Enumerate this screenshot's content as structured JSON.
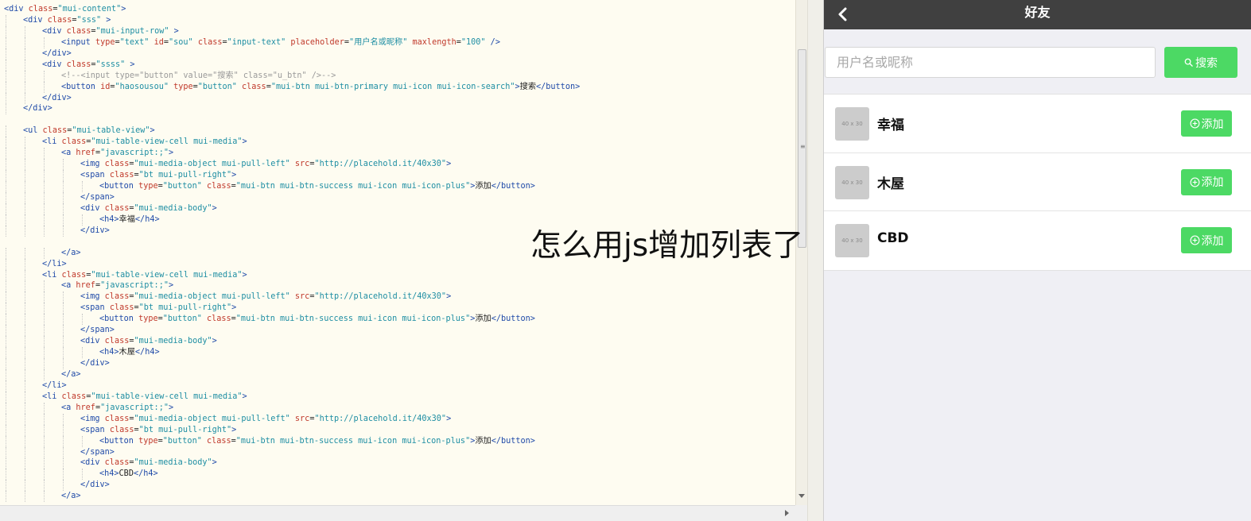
{
  "editor": {
    "lines": [
      {
        "indent": 0,
        "segs": [
          [
            "t",
            "<div "
          ],
          [
            "a",
            "class"
          ],
          [
            "x",
            "="
          ],
          [
            "s",
            "\"mui-content\""
          ],
          [
            "t",
            ">"
          ]
        ]
      },
      {
        "indent": 1,
        "segs": [
          [
            "t",
            "<div "
          ],
          [
            "a",
            "class"
          ],
          [
            "x",
            "="
          ],
          [
            "s",
            "\"sss\""
          ],
          [
            "t",
            " >"
          ]
        ]
      },
      {
        "indent": 2,
        "segs": [
          [
            "t",
            "<div "
          ],
          [
            "a",
            "class"
          ],
          [
            "x",
            "="
          ],
          [
            "s",
            "\"mui-input-row\""
          ],
          [
            "t",
            " >"
          ]
        ]
      },
      {
        "indent": 3,
        "segs": [
          [
            "t",
            "<input "
          ],
          [
            "a",
            "type"
          ],
          [
            "x",
            "="
          ],
          [
            "s",
            "\"text\""
          ],
          [
            "x",
            " "
          ],
          [
            "a",
            "id"
          ],
          [
            "x",
            "="
          ],
          [
            "s",
            "\"sou\""
          ],
          [
            "x",
            " "
          ],
          [
            "a",
            "class"
          ],
          [
            "x",
            "="
          ],
          [
            "s",
            "\"input-text\""
          ],
          [
            "x",
            " "
          ],
          [
            "a",
            "placeholder"
          ],
          [
            "x",
            "="
          ],
          [
            "s",
            "\"用户名或昵称\""
          ],
          [
            "x",
            " "
          ],
          [
            "a",
            "maxlength"
          ],
          [
            "x",
            "="
          ],
          [
            "s",
            "\"100\""
          ],
          [
            "t",
            " />"
          ]
        ]
      },
      {
        "indent": 2,
        "segs": [
          [
            "t",
            "</div>"
          ]
        ]
      },
      {
        "indent": 2,
        "segs": [
          [
            "t",
            "<div "
          ],
          [
            "a",
            "class"
          ],
          [
            "x",
            "="
          ],
          [
            "s",
            "\"ssss\""
          ],
          [
            "t",
            " >"
          ]
        ]
      },
      {
        "indent": 3,
        "segs": [
          [
            "c",
            "<!--<input type=\"button\" value=\"搜索\" class=\"u_btn\" />-->"
          ]
        ]
      },
      {
        "indent": 3,
        "segs": [
          [
            "t",
            "<button "
          ],
          [
            "a",
            "id"
          ],
          [
            "x",
            "="
          ],
          [
            "s",
            "\"haosousou\""
          ],
          [
            "x",
            " "
          ],
          [
            "a",
            "type"
          ],
          [
            "x",
            "="
          ],
          [
            "s",
            "\"button\""
          ],
          [
            "x",
            " "
          ],
          [
            "a",
            "class"
          ],
          [
            "x",
            "="
          ],
          [
            "s",
            "\"mui-btn mui-btn-primary mui-icon mui-icon-search\""
          ],
          [
            "t",
            ">"
          ],
          [
            "x",
            "搜索"
          ],
          [
            "t",
            "</button>"
          ]
        ]
      },
      {
        "indent": 2,
        "segs": [
          [
            "t",
            "</div>"
          ]
        ]
      },
      {
        "indent": 1,
        "segs": [
          [
            "t",
            "</div>"
          ]
        ]
      },
      {
        "indent": 0,
        "segs": []
      },
      {
        "indent": 1,
        "segs": [
          [
            "t",
            "<ul "
          ],
          [
            "a",
            "class"
          ],
          [
            "x",
            "="
          ],
          [
            "s",
            "\"mui-table-view\""
          ],
          [
            "t",
            ">"
          ]
        ]
      },
      {
        "indent": 2,
        "segs": [
          [
            "t",
            "<li "
          ],
          [
            "a",
            "class"
          ],
          [
            "x",
            "="
          ],
          [
            "s",
            "\"mui-table-view-cell mui-media\""
          ],
          [
            "t",
            ">"
          ]
        ]
      },
      {
        "indent": 3,
        "segs": [
          [
            "t",
            "<a "
          ],
          [
            "a",
            "href"
          ],
          [
            "x",
            "="
          ],
          [
            "s",
            "\"javascript:;\""
          ],
          [
            "t",
            ">"
          ]
        ]
      },
      {
        "indent": 4,
        "segs": [
          [
            "t",
            "<img "
          ],
          [
            "a",
            "class"
          ],
          [
            "x",
            "="
          ],
          [
            "s",
            "\"mui-media-object mui-pull-left\""
          ],
          [
            "x",
            " "
          ],
          [
            "a",
            "src"
          ],
          [
            "x",
            "="
          ],
          [
            "s",
            "\"http://placehold.it/40x30\""
          ],
          [
            "t",
            ">"
          ]
        ]
      },
      {
        "indent": 4,
        "segs": [
          [
            "t",
            "<span "
          ],
          [
            "a",
            "class"
          ],
          [
            "x",
            "="
          ],
          [
            "s",
            "\"bt mui-pull-right\""
          ],
          [
            "t",
            ">"
          ]
        ]
      },
      {
        "indent": 5,
        "segs": [
          [
            "t",
            "<button "
          ],
          [
            "a",
            "type"
          ],
          [
            "x",
            "="
          ],
          [
            "s",
            "\"button\""
          ],
          [
            "x",
            " "
          ],
          [
            "a",
            "class"
          ],
          [
            "x",
            "="
          ],
          [
            "s",
            "\"mui-btn mui-btn-success mui-icon mui-icon-plus\""
          ],
          [
            "t",
            ">"
          ],
          [
            "x",
            "添加"
          ],
          [
            "t",
            "</button>"
          ]
        ]
      },
      {
        "indent": 4,
        "segs": [
          [
            "t",
            "</span>"
          ]
        ]
      },
      {
        "indent": 4,
        "segs": [
          [
            "t",
            "<div "
          ],
          [
            "a",
            "class"
          ],
          [
            "x",
            "="
          ],
          [
            "s",
            "\"mui-media-body\""
          ],
          [
            "t",
            ">"
          ]
        ]
      },
      {
        "indent": 5,
        "segs": [
          [
            "t",
            "<h4>"
          ],
          [
            "x",
            "幸福"
          ],
          [
            "t",
            "</h4>"
          ]
        ]
      },
      {
        "indent": 4,
        "segs": [
          [
            "t",
            "</div>"
          ]
        ]
      },
      {
        "indent": 0,
        "segs": []
      },
      {
        "indent": 3,
        "segs": [
          [
            "t",
            "</a>"
          ]
        ]
      },
      {
        "indent": 2,
        "segs": [
          [
            "t",
            "</li>"
          ]
        ]
      },
      {
        "indent": 2,
        "segs": [
          [
            "t",
            "<li "
          ],
          [
            "a",
            "class"
          ],
          [
            "x",
            "="
          ],
          [
            "s",
            "\"mui-table-view-cell mui-media\""
          ],
          [
            "t",
            ">"
          ]
        ]
      },
      {
        "indent": 3,
        "segs": [
          [
            "t",
            "<a "
          ],
          [
            "a",
            "href"
          ],
          [
            "x",
            "="
          ],
          [
            "s",
            "\"javascript:;\""
          ],
          [
            "t",
            ">"
          ]
        ]
      },
      {
        "indent": 4,
        "segs": [
          [
            "t",
            "<img "
          ],
          [
            "a",
            "class"
          ],
          [
            "x",
            "="
          ],
          [
            "s",
            "\"mui-media-object mui-pull-left\""
          ],
          [
            "x",
            " "
          ],
          [
            "a",
            "src"
          ],
          [
            "x",
            "="
          ],
          [
            "s",
            "\"http://placehold.it/40x30\""
          ],
          [
            "t",
            ">"
          ]
        ]
      },
      {
        "indent": 4,
        "segs": [
          [
            "t",
            "<span "
          ],
          [
            "a",
            "class"
          ],
          [
            "x",
            "="
          ],
          [
            "s",
            "\"bt mui-pull-right\""
          ],
          [
            "t",
            ">"
          ]
        ]
      },
      {
        "indent": 5,
        "segs": [
          [
            "t",
            "<button "
          ],
          [
            "a",
            "type"
          ],
          [
            "x",
            "="
          ],
          [
            "s",
            "\"button\""
          ],
          [
            "x",
            " "
          ],
          [
            "a",
            "class"
          ],
          [
            "x",
            "="
          ],
          [
            "s",
            "\"mui-btn mui-btn-success mui-icon mui-icon-plus\""
          ],
          [
            "t",
            ">"
          ],
          [
            "x",
            "添加"
          ],
          [
            "t",
            "</button>"
          ]
        ]
      },
      {
        "indent": 4,
        "segs": [
          [
            "t",
            "</span>"
          ]
        ]
      },
      {
        "indent": 4,
        "segs": [
          [
            "t",
            "<div "
          ],
          [
            "a",
            "class"
          ],
          [
            "x",
            "="
          ],
          [
            "s",
            "\"mui-media-body\""
          ],
          [
            "t",
            ">"
          ]
        ]
      },
      {
        "indent": 5,
        "segs": [
          [
            "t",
            "<h4>"
          ],
          [
            "x",
            "木屋"
          ],
          [
            "t",
            "</h4>"
          ]
        ]
      },
      {
        "indent": 4,
        "segs": [
          [
            "t",
            "</div>"
          ]
        ]
      },
      {
        "indent": 3,
        "segs": [
          [
            "t",
            "</a>"
          ]
        ]
      },
      {
        "indent": 2,
        "segs": [
          [
            "t",
            "</li>"
          ]
        ]
      },
      {
        "indent": 2,
        "segs": [
          [
            "t",
            "<li "
          ],
          [
            "a",
            "class"
          ],
          [
            "x",
            "="
          ],
          [
            "s",
            "\"mui-table-view-cell mui-media\""
          ],
          [
            "t",
            ">"
          ]
        ]
      },
      {
        "indent": 3,
        "segs": [
          [
            "t",
            "<a "
          ],
          [
            "a",
            "href"
          ],
          [
            "x",
            "="
          ],
          [
            "s",
            "\"javascript:;\""
          ],
          [
            "t",
            ">"
          ]
        ]
      },
      {
        "indent": 4,
        "segs": [
          [
            "t",
            "<img "
          ],
          [
            "a",
            "class"
          ],
          [
            "x",
            "="
          ],
          [
            "s",
            "\"mui-media-object mui-pull-left\""
          ],
          [
            "x",
            " "
          ],
          [
            "a",
            "src"
          ],
          [
            "x",
            "="
          ],
          [
            "s",
            "\"http://placehold.it/40x30\""
          ],
          [
            "t",
            ">"
          ]
        ]
      },
      {
        "indent": 4,
        "segs": [
          [
            "t",
            "<span "
          ],
          [
            "a",
            "class"
          ],
          [
            "x",
            "="
          ],
          [
            "s",
            "\"bt mui-pull-right\""
          ],
          [
            "t",
            ">"
          ]
        ]
      },
      {
        "indent": 5,
        "segs": [
          [
            "t",
            "<button "
          ],
          [
            "a",
            "type"
          ],
          [
            "x",
            "="
          ],
          [
            "s",
            "\"button\""
          ],
          [
            "x",
            " "
          ],
          [
            "a",
            "class"
          ],
          [
            "x",
            "="
          ],
          [
            "s",
            "\"mui-btn mui-btn-success mui-icon mui-icon-plus\""
          ],
          [
            "t",
            ">"
          ],
          [
            "x",
            "添加"
          ],
          [
            "t",
            "</button>"
          ]
        ]
      },
      {
        "indent": 4,
        "segs": [
          [
            "t",
            "</span>"
          ]
        ]
      },
      {
        "indent": 4,
        "segs": [
          [
            "t",
            "<div "
          ],
          [
            "a",
            "class"
          ],
          [
            "x",
            "="
          ],
          [
            "s",
            "\"mui-media-body\""
          ],
          [
            "t",
            ">"
          ]
        ]
      },
      {
        "indent": 5,
        "segs": [
          [
            "t",
            "<h4>"
          ],
          [
            "x",
            "CBD"
          ],
          [
            "t",
            "</h4>"
          ]
        ]
      },
      {
        "indent": 4,
        "segs": [
          [
            "t",
            "</div>"
          ]
        ]
      },
      {
        "indent": 3,
        "segs": [
          [
            "t",
            "</a>"
          ]
        ]
      }
    ]
  },
  "overlay_text": "怎么用js增加列表了",
  "phone": {
    "nav_title": "好友",
    "back_icon": "chevron-left-icon",
    "search": {
      "placeholder": "用户名或昵称",
      "value": "",
      "button_label": "搜索",
      "button_icon": "search-icon"
    },
    "list": [
      {
        "thumb_text": "40 x 30",
        "name": "幸福",
        "add_label": "添加"
      },
      {
        "thumb_text": "40 x 30",
        "name": "木屋",
        "add_label": "添加"
      },
      {
        "thumb_text": "40 x 30",
        "name": "CBD",
        "add_label": "添加"
      }
    ],
    "colors": {
      "navbar_bg": "#404040",
      "success_green": "#4cd964",
      "page_bg": "#efeff4"
    }
  }
}
